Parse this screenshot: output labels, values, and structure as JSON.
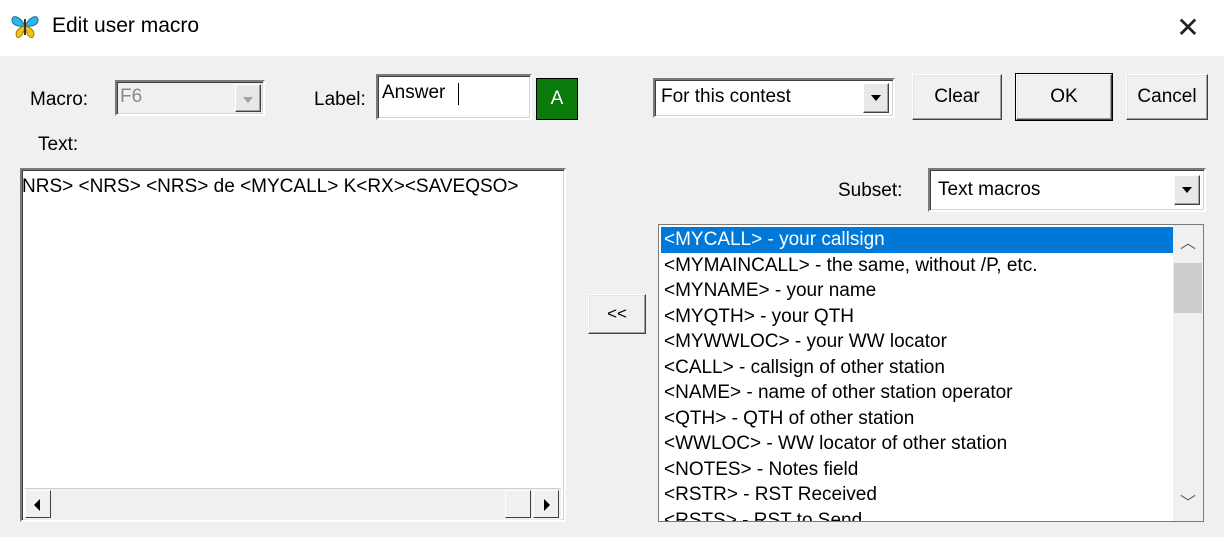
{
  "window": {
    "title": "Edit user macro",
    "close_glyph": "✕"
  },
  "macro": {
    "label": "Macro:",
    "value": "F6"
  },
  "label_field": {
    "label": "Label:",
    "value": "Answer",
    "color_button": "A",
    "color": "#0a7a0a"
  },
  "scope": {
    "selected": "For this contest"
  },
  "buttons": {
    "clear": "Clear",
    "ok": "OK",
    "cancel": "Cancel",
    "insert": "<<"
  },
  "text_area": {
    "label": "Text:",
    "value": "NRS> <NRS> <NRS> de <MYCALL> K<RX><SAVEQSO>"
  },
  "subset": {
    "label": "Subset:",
    "selected": "Text macros"
  },
  "macro_list": {
    "selected_index": 0,
    "items": [
      "<MYCALL> - your callsign",
      "<MYMAINCALL> - the same, without /P, etc.",
      "<MYNAME> - your name",
      "<MYQTH> - your QTH",
      "<MYWWLOC> - your WW locator",
      "<CALL> - callsign of other station",
      "<NAME> - name of other station operator",
      "<QTH> - QTH of other station",
      "<WWLOC> - WW locator of other station",
      "<NOTES> - Notes field",
      "<RSTR> - RST Received",
      "<RSTS> - RST to Send"
    ]
  },
  "colors": {
    "selection": "#0078d7",
    "dialog_bg": "#f0f0f0"
  },
  "icons": {
    "app": "butterfly-icon",
    "close": "close-icon"
  }
}
